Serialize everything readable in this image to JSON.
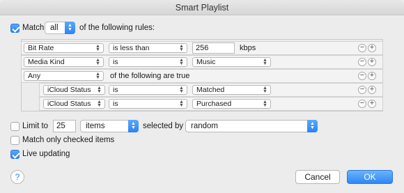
{
  "window": {
    "title": "Smart Playlist"
  },
  "match": {
    "checkbox_label": "Match",
    "quantifier": "all",
    "suffix": "of the following rules:",
    "checked": true
  },
  "rules": [
    {
      "field": "Bit Rate",
      "operator": "is less than",
      "value": "256",
      "unit": "kbps"
    },
    {
      "field": "Media Kind",
      "operator": "is",
      "value": "Music"
    },
    {
      "field": "Any",
      "operator_text": "of the following are true"
    },
    {
      "field": "iCloud Status",
      "operator": "is",
      "value": "Matched"
    },
    {
      "field": "iCloud Status",
      "operator": "is",
      "value": "Purchased"
    }
  ],
  "buttons": {
    "minus": "−",
    "plus": "+"
  },
  "limit": {
    "label": "Limit to",
    "value": "25",
    "unit": "items",
    "selected_by_label": "selected by",
    "selected_by": "random",
    "checked": false
  },
  "match_checked": {
    "label": "Match only checked items",
    "checked": false
  },
  "live_updating": {
    "label": "Live updating",
    "checked": true
  },
  "footer": {
    "help": "?",
    "cancel": "Cancel",
    "ok": "OK"
  },
  "colors": {
    "accent": "#2a84f5",
    "window_bg": "#ececec"
  }
}
